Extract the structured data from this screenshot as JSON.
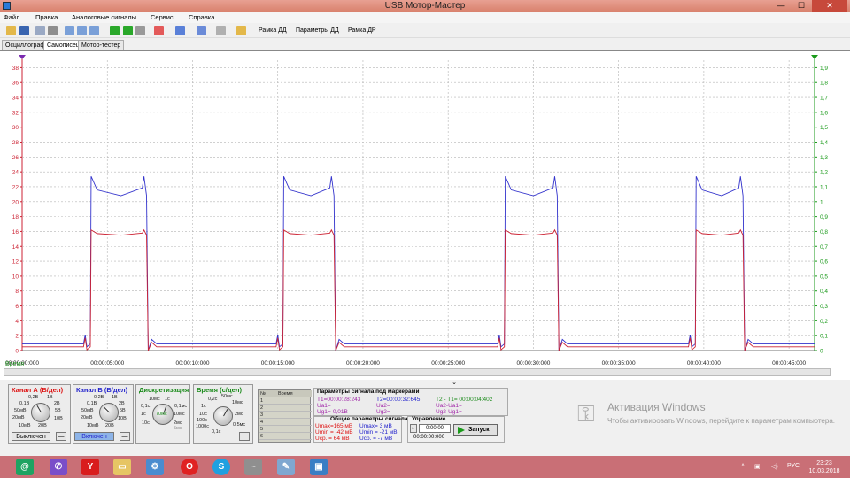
{
  "window": {
    "title": "USB Мотор-Мастер",
    "minimize": "—",
    "maximize": "☐",
    "close": "✕"
  },
  "menu": [
    "Файл",
    "Правка",
    "Аналоговые сигналы",
    "Сервис",
    "Справка"
  ],
  "toolbar": {
    "frame_dd": "Рамка ДД",
    "params_dd": "Параметры ДД",
    "frame_dr": "Рамка ДР"
  },
  "tabs": [
    "Осциллограф",
    "Самописец",
    "Мотор-тестер"
  ],
  "active_tab": "Самописец",
  "chart_data": {
    "type": "line",
    "xlabel": "Время",
    "x_ticks": [
      "00:00:00:000",
      "00:00:05:000",
      "00:00:10:000",
      "00:00:15:000",
      "00:00:20:000",
      "00:00:25:000",
      "00:00:30:000",
      "00:00:35:000",
      "00:00:40:000",
      "00:00:45:000"
    ],
    "xlim_seconds": [
      0,
      46.5
    ],
    "y_left": {
      "ylim": [
        0,
        39
      ],
      "ticks": [
        0,
        2,
        4,
        6,
        8,
        10,
        12,
        14,
        16,
        18,
        20,
        22,
        24,
        26,
        28,
        30,
        32,
        34,
        36,
        38
      ]
    },
    "y_right": {
      "ylim": [
        0,
        1.95
      ],
      "ticks": [
        "0",
        "0,1",
        "0,2",
        "0,3",
        "0,4",
        "0,5",
        "0,6",
        "0,7",
        "0,8",
        "0,9",
        "1",
        "1,1",
        "1,2",
        "1,3",
        "1,4",
        "1,5",
        "1,6",
        "1,7",
        "1,8",
        "1,9"
      ]
    },
    "grid": true,
    "series": [
      {
        "color": "#3333cc",
        "pulses": [
          {
            "start": 4.0,
            "end": 7.6
          },
          {
            "start": 15.3,
            "end": 18.6
          },
          {
            "start": 28.3,
            "end": 31.7
          },
          {
            "start": 39.5,
            "end": 42.6
          }
        ],
        "peak": 23.4,
        "plateau": 20.8,
        "baseline": 0.9
      },
      {
        "color": "#cc2233",
        "pulses": [
          {
            "start": 4.0,
            "end": 7.6
          },
          {
            "start": 15.3,
            "end": 18.6
          },
          {
            "start": 28.3,
            "end": 31.7
          },
          {
            "start": 39.5,
            "end": 42.6
          }
        ],
        "peak": 16.2,
        "plateau": 15.5,
        "baseline": 0.5
      }
    ]
  },
  "channel_a": {
    "title": "Канал А (В/дел)",
    "labels": [
      "0,2В",
      "1В",
      "0,1В",
      "2В",
      "50мВ",
      "5В",
      "20мВ",
      "10В",
      "10мВ",
      "20В"
    ],
    "toggle": "Выключен",
    "minus": "—"
  },
  "channel_b": {
    "title": "Канал В (В/дел)",
    "labels": [
      "0,2В",
      "1В",
      "0,1В",
      "2В",
      "50мВ",
      "5В",
      "20мВ",
      "10В",
      "10мВ",
      "20В"
    ],
    "toggle": "Включен",
    "minus": "—"
  },
  "sampling": {
    "title": "Дискретизация",
    "labels": [
      "10мс",
      "1с",
      "0,1с",
      "0,1мс",
      "1с",
      "70мс",
      "10мс",
      "10с",
      "2мс",
      "5мс"
    ]
  },
  "time": {
    "title": "Время (с/дел)",
    "labels": [
      "0,2с",
      "50мс",
      "10мс",
      "1с",
      "10с",
      "2мс",
      "100с",
      "0,5мс",
      "1000с",
      "0,1с"
    ]
  },
  "marker_table": {
    "header_num": "№",
    "header_time": "Время",
    "rows": [
      "1",
      "2",
      "3",
      "4",
      "5",
      "6"
    ]
  },
  "signal_params": {
    "title": "Параметры сигнала под маркерами",
    "t1": "T1=00:00:28:243",
    "t2": "T2=00:00:32:645",
    "dt": "T2 - T1= 00:00:04:402",
    "ua1": "Ua1=",
    "ua2": "Ua2=",
    "dua": "Ua2-Ua1=",
    "ug1": "Ug1=-0,01В",
    "ug2": "Ug2=",
    "dug": "Ug2-Ug1="
  },
  "general_params": {
    "title": "Общие параметры сигнала",
    "a_max": "Umax=165 мВ",
    "a_min": "Umin = -42 мВ",
    "a_avg": "Uср. = 64 мВ",
    "b_max": "Umax= 3 мВ",
    "b_min": "Umin = -21 мВ",
    "b_avg": "Uср. = -7 мВ"
  },
  "control": {
    "title": "Управление",
    "time_value": "0:00:00",
    "counter": "00:00:00:000",
    "run": "Запуск"
  },
  "activation": {
    "title": "Активация Windows",
    "text": "Чтобы активировать Windows, перейдите к параметрам компьютера."
  },
  "taskbar": {
    "lang": "РУС",
    "time": "23:23",
    "date": "10.03.2018",
    "icons": [
      "hangouts",
      "viber",
      "yandex",
      "explorer",
      "settings",
      "opera",
      "skype",
      "oscilloscope",
      "paint",
      "photos"
    ]
  }
}
